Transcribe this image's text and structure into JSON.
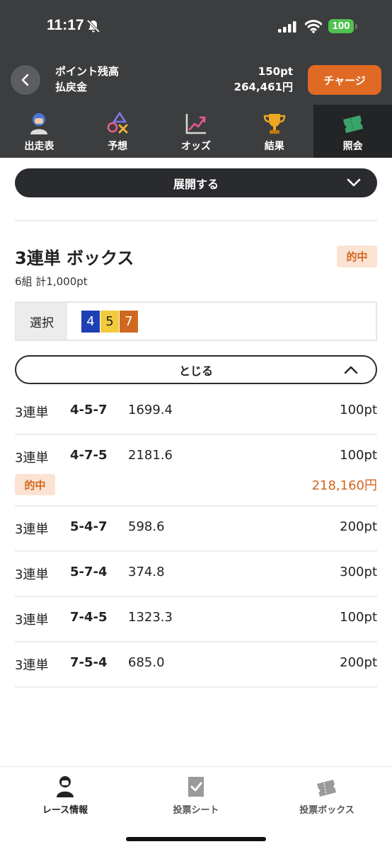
{
  "status_bar": {
    "time": "11:17",
    "battery": "100"
  },
  "header": {
    "point_label": "ポイント残高",
    "refund_label": "払戻金",
    "point_value": "150pt",
    "refund_value": "264,461円",
    "charge_button": "チャージ"
  },
  "tabs": [
    {
      "label": "出走表",
      "icon": "jockey-icon"
    },
    {
      "label": "予想",
      "icon": "shapes-icon"
    },
    {
      "label": "オッズ",
      "icon": "chart-icon"
    },
    {
      "label": "結果",
      "icon": "trophy-icon"
    },
    {
      "label": "照会",
      "icon": "ticket-icon",
      "active": true
    }
  ],
  "expand_button": "展開する",
  "bet_group": {
    "title": "3連単 ボックス",
    "hit_badge": "的中",
    "subtitle": "6組 計1,000pt",
    "select_label": "選択",
    "numbers": [
      {
        "n": "4",
        "bg": "#1f3fb5",
        "fg": "#ffffff"
      },
      {
        "n": "5",
        "bg": "#f2cb3d",
        "fg": "#222222"
      },
      {
        "n": "7",
        "bg": "#d0691f",
        "fg": "#ffffff"
      }
    ],
    "close_button": "とじる"
  },
  "bets": [
    {
      "type": "3連単",
      "combo": "4-5-7",
      "odds": "1699.4",
      "amount": "100pt"
    },
    {
      "type": "3連単",
      "combo": "4-7-5",
      "odds": "2181.6",
      "amount": "100pt",
      "hit": "的中",
      "payout": "218,160円"
    },
    {
      "type": "3連単",
      "combo": "5-4-7",
      "odds": "598.6",
      "amount": "200pt"
    },
    {
      "type": "3連単",
      "combo": "5-7-4",
      "odds": "374.8",
      "amount": "300pt"
    },
    {
      "type": "3連単",
      "combo": "7-4-5",
      "odds": "1323.3",
      "amount": "100pt"
    },
    {
      "type": "3連単",
      "combo": "7-5-4",
      "odds": "685.0",
      "amount": "200pt"
    }
  ],
  "bottom_nav": [
    {
      "label": "レース情報",
      "icon": "jockey-icon",
      "active": true
    },
    {
      "label": "投票シート",
      "icon": "checksheet-icon"
    },
    {
      "label": "投票ボックス",
      "icon": "tickets-icon"
    }
  ],
  "colors": {
    "accent": "#e06a24",
    "dark": "#3c3d3f",
    "hit": "#d2661f"
  }
}
